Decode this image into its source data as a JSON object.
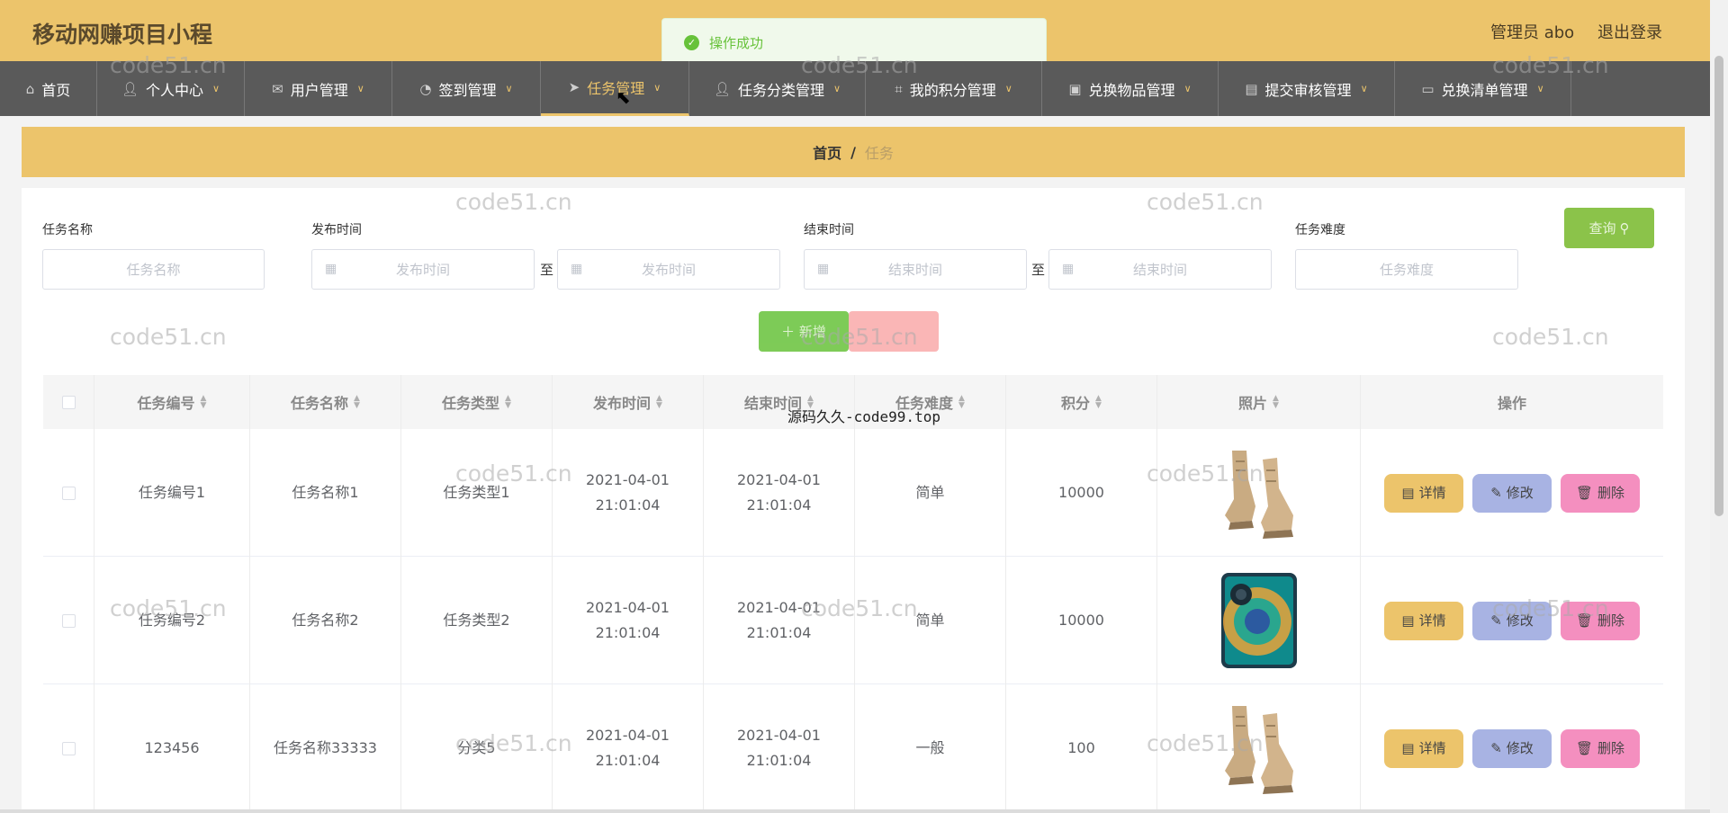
{
  "header": {
    "title": "移动网赚项目小程",
    "user": "管理员 abo",
    "logout": "退出登录"
  },
  "toast": {
    "text": "操作成功",
    "icon": "check-circle-icon",
    "color": "#67c23a"
  },
  "nav": {
    "active_index": 4,
    "items": [
      {
        "label": "首页",
        "icon": "home-icon",
        "dropdown": false
      },
      {
        "label": "个人中心",
        "icon": "user-icon",
        "dropdown": true
      },
      {
        "label": "用户管理",
        "icon": "mail-icon",
        "dropdown": true
      },
      {
        "label": "签到管理",
        "icon": "compass-icon",
        "dropdown": true
      },
      {
        "label": "任务管理",
        "icon": "send-icon",
        "dropdown": true
      },
      {
        "label": "任务分类管理",
        "icon": "user-icon",
        "dropdown": true
      },
      {
        "label": "我的积分管理",
        "icon": "crop-icon",
        "dropdown": true
      },
      {
        "label": "兑换物品管理",
        "icon": "briefcase-icon",
        "dropdown": true
      },
      {
        "label": "提交审核管理",
        "icon": "clipboard-icon",
        "dropdown": true
      },
      {
        "label": "兑换清单管理",
        "icon": "monitor-icon",
        "dropdown": true
      }
    ]
  },
  "breadcrumb": {
    "home": "首页",
    "separator": "/",
    "current": "任务"
  },
  "filters": {
    "task_name": {
      "label": "任务名称",
      "placeholder": "任务名称"
    },
    "publish_time": {
      "label": "发布时间",
      "start_placeholder": "发布时间",
      "end_placeholder": "发布时间",
      "range_sep": "至"
    },
    "end_time": {
      "label": "结束时间",
      "start_placeholder": "结束时间",
      "end_placeholder": "结束时间",
      "range_sep": "至"
    },
    "difficulty": {
      "label": "任务难度",
      "placeholder": "任务难度"
    },
    "query_button": "查询"
  },
  "actions": {
    "add_button": "＋ 新增"
  },
  "table": {
    "columns": [
      "任务编号",
      "任务名称",
      "任务类型",
      "发布时间",
      "结束时间",
      "任务难度",
      "积分",
      "照片",
      "操作"
    ],
    "rows": [
      {
        "id": "任务编号1",
        "name": "任务名称1",
        "type": "任务类型1",
        "publish_time": "2021-04-01 21:01:04",
        "end_time": "2021-04-01 21:01:04",
        "difficulty": "简单",
        "points": "10000",
        "photo": "boots"
      },
      {
        "id": "任务编号2",
        "name": "任务名称2",
        "type": "任务类型2",
        "publish_time": "2021-04-01 21:01:04",
        "end_time": "2021-04-01 21:01:04",
        "difficulty": "简单",
        "points": "10000",
        "photo": "phone"
      },
      {
        "id": "123456",
        "name": "任务名称33333",
        "type": "分类5",
        "publish_time": "2021-04-01 21:01:04",
        "end_time": "2021-04-01 21:01:04",
        "difficulty": "一般",
        "points": "100",
        "photo": "boots"
      }
    ],
    "row_actions": {
      "detail": "详情",
      "edit": "修改",
      "delete": "删除"
    }
  },
  "watermark": {
    "text": "code51.cn",
    "center_text": "源码久久-code99.top"
  },
  "colors": {
    "header": "#ecc46b",
    "nav": "#5a5a5a",
    "query": "#8bc34a",
    "detail": "#ecc46b",
    "edit": "#a8b3e3",
    "delete": "#f48fbf"
  }
}
